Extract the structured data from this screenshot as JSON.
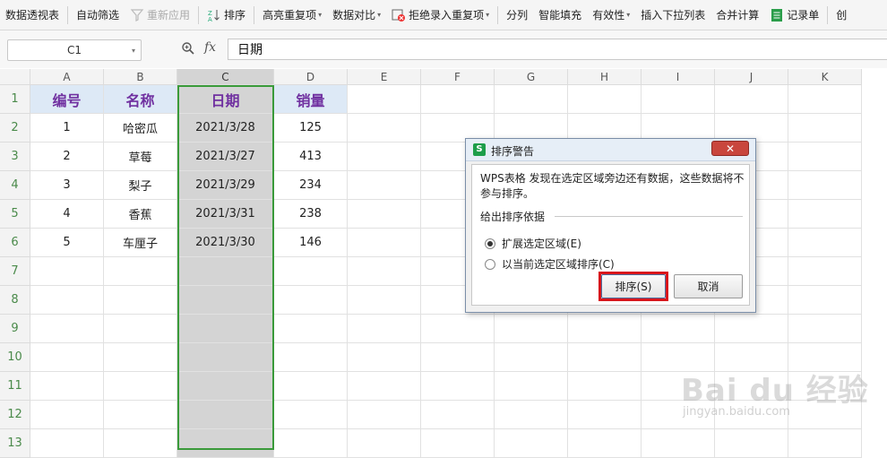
{
  "toolbar": {
    "items": [
      {
        "label": "数据透视表",
        "enabled": true
      },
      {
        "label": "自动筛选",
        "enabled": true
      },
      {
        "label": "重新应用",
        "enabled": false
      },
      {
        "label": "排序",
        "enabled": true
      },
      {
        "label": "高亮重复项",
        "enabled": true,
        "dropdown": true
      },
      {
        "label": "数据对比",
        "enabled": true,
        "dropdown": true
      },
      {
        "label": "拒绝录入重复项",
        "enabled": true,
        "dropdown": true
      },
      {
        "label": "分列",
        "enabled": true
      },
      {
        "label": "智能填充",
        "enabled": true
      },
      {
        "label": "有效性",
        "enabled": true,
        "dropdown": true
      },
      {
        "label": "插入下拉列表",
        "enabled": true
      },
      {
        "label": "合并计算",
        "enabled": true
      },
      {
        "label": "记录单",
        "enabled": true
      },
      {
        "label": "创",
        "enabled": true
      }
    ]
  },
  "formula_bar": {
    "name_box": "C1",
    "fx_label": "fx",
    "formula": "日期"
  },
  "columns": [
    "A",
    "B",
    "C",
    "D",
    "E",
    "F",
    "G",
    "H",
    "I",
    "J",
    "K"
  ],
  "rows": [
    "1",
    "2",
    "3",
    "4",
    "5",
    "6",
    "7",
    "8",
    "9",
    "10",
    "11",
    "12",
    "13"
  ],
  "sheet": {
    "headers": [
      "编号",
      "名称",
      "日期",
      "销量"
    ],
    "data": [
      [
        "1",
        "哈密瓜",
        "2021/3/28",
        "125"
      ],
      [
        "2",
        "草莓",
        "2021/3/27",
        "413"
      ],
      [
        "3",
        "梨子",
        "2021/3/29",
        "234"
      ],
      [
        "4",
        "香蕉",
        "2021/3/31",
        "238"
      ],
      [
        "5",
        "车厘子",
        "2021/3/30",
        "146"
      ]
    ],
    "selected_column": "C",
    "selection_color": "#3a9a3a",
    "header_text_color": "#7030a0",
    "header_fill": "#dde9f6"
  },
  "dialog": {
    "title": "排序警告",
    "logo": "S",
    "close_label": "✕",
    "message": "WPS表格 发现在选定区域旁边还有数据，这些数据将不参与排序。",
    "group_label": "给出排序依据",
    "options": [
      {
        "label": "扩展选定区域(E)",
        "selected": true
      },
      {
        "label": "以当前选定区域排序(C)",
        "selected": false
      }
    ],
    "sort_button": "排序(S)",
    "cancel_button": "取消",
    "highlight_color": "#d9161b"
  },
  "watermark": {
    "brand": "Bai du 经验",
    "url": "jingyan.baidu.com"
  }
}
